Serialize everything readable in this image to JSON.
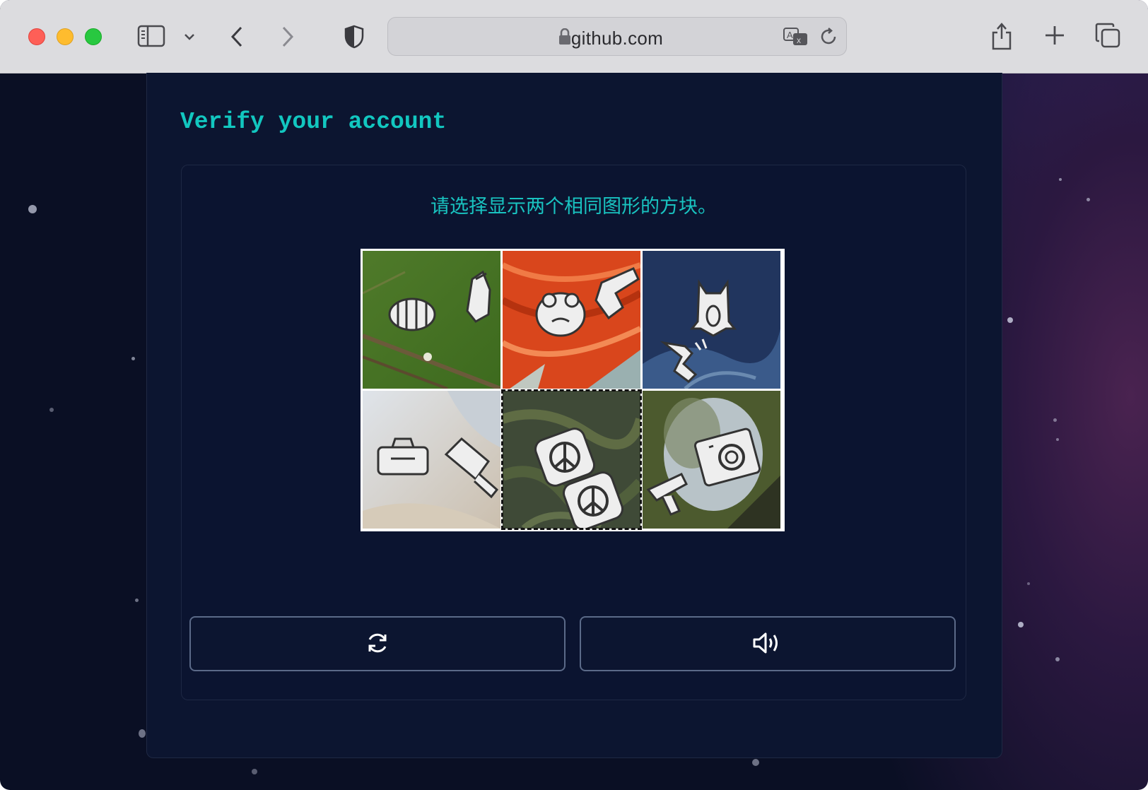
{
  "browser": {
    "url": "github.com",
    "icons": {
      "sidebar": "sidebar-icon",
      "chevron": "chevron-down-icon",
      "back": "back-arrow-icon",
      "forward": "forward-arrow-icon",
      "privacy": "shield-icon",
      "lock": "lock-icon",
      "translate": "translate-icon",
      "reload": "reload-icon",
      "share": "share-icon",
      "new_tab": "plus-icon",
      "tabs": "tab-overview-icon"
    }
  },
  "page": {
    "title": "Verify your account",
    "instruction": "请选择显示两个相同图形的方块。",
    "tiles": [
      {
        "name": "tile-1",
        "background": "green-foliage",
        "icons": [
          "lantern-icon",
          "hand-icon"
        ]
      },
      {
        "name": "tile-2",
        "background": "red-feathers",
        "icons": [
          "frog-icon",
          "hand-pointing-icon"
        ]
      },
      {
        "name": "tile-3",
        "background": "blue-rock",
        "icons": [
          "owl-icon",
          "skydiver-icon"
        ]
      },
      {
        "name": "tile-4",
        "background": "white-fur",
        "icons": [
          "bag-icon",
          "flashlight-icon"
        ]
      },
      {
        "name": "tile-5",
        "background": "moss-stone",
        "icons": [
          "peace-sign-icon",
          "peace-sign-icon"
        ],
        "selected": true
      },
      {
        "name": "tile-6",
        "background": "bark",
        "icons": [
          "washing-machine-icon",
          "drill-icon"
        ]
      }
    ],
    "buttons": {
      "refresh_icon": "refresh-icon",
      "audio_icon": "speaker-icon"
    }
  },
  "colors": {
    "accent": "#12c7c0",
    "panel": "#0c1530",
    "background": "#0a0f24",
    "selection_outline": "#111111"
  }
}
